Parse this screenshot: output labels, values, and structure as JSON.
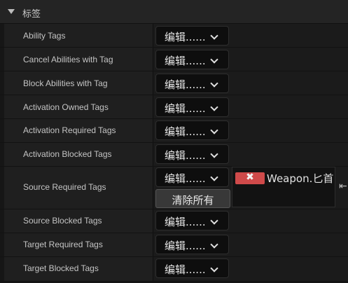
{
  "section": {
    "title": "标签"
  },
  "combo_label": "编辑......",
  "clear_all_label": "清除所有",
  "tag_chip_x": "✖",
  "rows": [
    {
      "label": "Ability Tags"
    },
    {
      "label": "Cancel Abilities with Tag"
    },
    {
      "label": "Block Abilities with Tag"
    },
    {
      "label": "Activation Owned Tags"
    },
    {
      "label": "Activation Required Tags"
    },
    {
      "label": "Activation Blocked Tags"
    },
    {
      "label": "Source Required Tags",
      "tags": [
        "Weapon.匕首"
      ]
    },
    {
      "label": "Source Blocked Tags"
    },
    {
      "label": "Target Required Tags"
    },
    {
      "label": "Target Blocked Tags"
    }
  ],
  "reset_glyph": "⇤"
}
